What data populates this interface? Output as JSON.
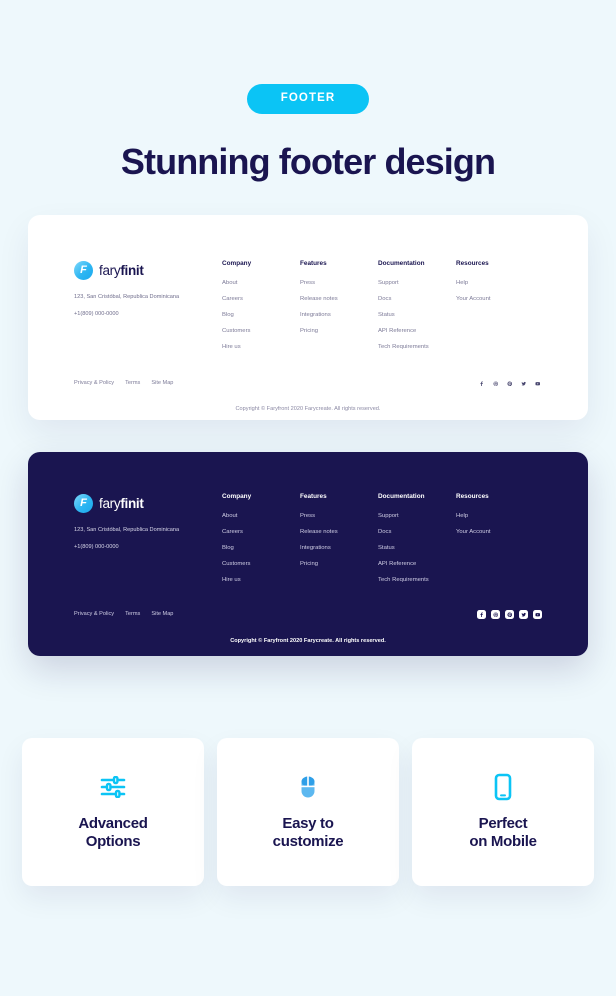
{
  "header": {
    "badge_label": "FOOTER",
    "title": "Stunning footer design",
    "badge_color": "#0bc4f5",
    "title_color": "#1a1550"
  },
  "footer": {
    "brand": {
      "mark_letter": "F",
      "name_light": "fary",
      "name_bold": "finit",
      "address": "123, San Cristóbal, Republica Dominicana",
      "phone": "+1(809) 000-0000"
    },
    "columns": [
      {
        "title": "Company",
        "links": [
          "About",
          "Careers",
          "Blog",
          "Customers",
          "Hire us"
        ]
      },
      {
        "title": "Features",
        "links": [
          "Press",
          "Release notes",
          "Integrations",
          "Pricing"
        ]
      },
      {
        "title": "Documentation",
        "links": [
          "Support",
          "Docs",
          "Status",
          "API Reference",
          "Tech Requirements"
        ]
      },
      {
        "title": "Resources",
        "links": [
          "Help",
          "Your Account"
        ]
      }
    ],
    "legal_links": [
      "Privacy & Policy",
      "Terms",
      "Site Map"
    ],
    "socials": [
      "facebook-icon",
      "dribbble-icon",
      "pinterest-icon",
      "twitter-icon",
      "youtube-icon"
    ],
    "copyright": "Copyright © Faryfront 2020 Farycreate. All rights reserved.",
    "light_background": "#ffffff",
    "dark_background": "#1a1550"
  },
  "features": [
    {
      "icon": "sliders-icon",
      "label_line1": "Advanced",
      "label_line2": "Options",
      "icon_color": "#0bc4f5"
    },
    {
      "icon": "mouse-icon",
      "label_line1": "Easy to",
      "label_line2": "customize",
      "icon_color": "#5cb8f0"
    },
    {
      "icon": "mobile-icon",
      "label_line1": "Perfect",
      "label_line2": "on Mobile",
      "icon_color": "#0bc4f5"
    }
  ],
  "page": {
    "background_color": "#eef8fc"
  }
}
